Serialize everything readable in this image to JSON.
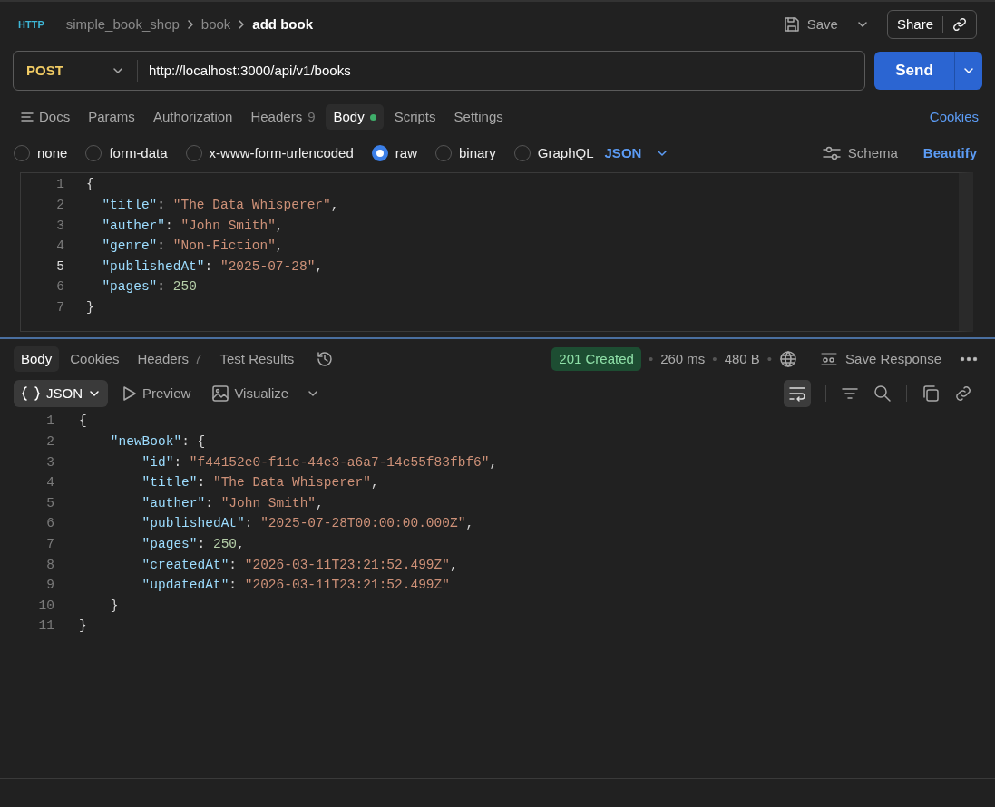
{
  "breadcrumb": {
    "badge": "HTTP",
    "items": [
      "simple_book_shop",
      "book"
    ],
    "current": "add book"
  },
  "actions": {
    "save": "Save",
    "share": "Share"
  },
  "request": {
    "method": "POST",
    "url": "http://localhost:3000/api/v1/books",
    "send": "Send"
  },
  "request_tabs": [
    {
      "label": "Docs",
      "kind": "docs",
      "selected": false
    },
    {
      "label": "Params",
      "selected": false
    },
    {
      "label": "Authorization",
      "selected": false
    },
    {
      "label": "Headers",
      "count": "9",
      "selected": false
    },
    {
      "label": "Body",
      "dot": true,
      "selected": true
    },
    {
      "label": "Scripts",
      "selected": false
    },
    {
      "label": "Settings",
      "selected": false
    }
  ],
  "cookies_link": "Cookies",
  "body_types": [
    {
      "label": "none",
      "selected": false
    },
    {
      "label": "form-data",
      "selected": false
    },
    {
      "label": "x-www-form-urlencoded",
      "selected": false
    },
    {
      "label": "raw",
      "selected": true
    },
    {
      "label": "binary",
      "selected": false
    },
    {
      "label": "GraphQL",
      "selected": false
    }
  ],
  "raw_format": "JSON",
  "schema": "Schema",
  "beautify": "Beautify",
  "request_body": [
    {
      "number": "1",
      "selected": false,
      "tokens": [
        {
          "kind": "punct",
          "text": "{"
        }
      ]
    },
    {
      "number": "2",
      "selected": false,
      "tokens": [
        {
          "kind": "key",
          "text": "  \"title\""
        },
        {
          "kind": "punct",
          "text": ": "
        },
        {
          "kind": "string",
          "text": "\"The Data Whisperer\""
        },
        {
          "kind": "punct",
          "text": ","
        }
      ]
    },
    {
      "number": "3",
      "selected": false,
      "tokens": [
        {
          "kind": "key",
          "text": "  \"auther\""
        },
        {
          "kind": "punct",
          "text": ": "
        },
        {
          "kind": "string",
          "text": "\"John Smith\""
        },
        {
          "kind": "punct",
          "text": ","
        }
      ]
    },
    {
      "number": "4",
      "selected": false,
      "tokens": [
        {
          "kind": "key",
          "text": "  \"genre\""
        },
        {
          "kind": "punct",
          "text": ": "
        },
        {
          "kind": "string",
          "text": "\"Non-Fiction\""
        },
        {
          "kind": "punct",
          "text": ","
        }
      ]
    },
    {
      "number": "5",
      "selected": true,
      "tokens": [
        {
          "kind": "key",
          "text": "  \"publishedAt\""
        },
        {
          "kind": "punct",
          "text": ": "
        },
        {
          "kind": "string",
          "text": "\"2025-07-28\""
        },
        {
          "kind": "punct",
          "text": ","
        }
      ]
    },
    {
      "number": "6",
      "selected": false,
      "tokens": [
        {
          "kind": "key",
          "text": "  \"pages\""
        },
        {
          "kind": "punct",
          "text": ": "
        },
        {
          "kind": "number",
          "text": "250"
        }
      ]
    },
    {
      "number": "7",
      "selected": false,
      "tokens": [
        {
          "kind": "punct",
          "text": "}"
        }
      ]
    }
  ],
  "response_tabs": [
    {
      "label": "Body",
      "selected": true
    },
    {
      "label": "Cookies",
      "selected": false
    },
    {
      "label": "Headers",
      "count": "7",
      "selected": false
    },
    {
      "label": "Test Results",
      "selected": false
    }
  ],
  "response_status": {
    "status": "201 Created",
    "separator": "•",
    "time": "260 ms",
    "size": "480 B",
    "save_response": "Save Response"
  },
  "response_views": [
    {
      "label": "JSON",
      "kind": "json",
      "selected": true
    },
    {
      "label": "Preview",
      "kind": "preview",
      "selected": false
    },
    {
      "label": "Visualize",
      "kind": "visualize",
      "selected": false
    }
  ],
  "wrap_lines": {
    "on": true
  },
  "response_body": [
    {
      "number": "1",
      "tokens": [
        {
          "kind": "punct",
          "text": "{"
        }
      ]
    },
    {
      "number": "2",
      "tokens": [
        {
          "kind": "key",
          "text": "    \"newBook\""
        },
        {
          "kind": "punct",
          "text": ": {"
        }
      ]
    },
    {
      "number": "3",
      "tokens": [
        {
          "kind": "key",
          "text": "        \"id\""
        },
        {
          "kind": "punct",
          "text": ": "
        },
        {
          "kind": "string",
          "text": "\"f44152e0-f11c-44e3-a6a7-14c55f83fbf6\""
        },
        {
          "kind": "punct",
          "text": ","
        }
      ]
    },
    {
      "number": "4",
      "tokens": [
        {
          "kind": "key",
          "text": "        \"title\""
        },
        {
          "kind": "punct",
          "text": ": "
        },
        {
          "kind": "string",
          "text": "\"The Data Whisperer\""
        },
        {
          "kind": "punct",
          "text": ","
        }
      ]
    },
    {
      "number": "5",
      "tokens": [
        {
          "kind": "key",
          "text": "        \"auther\""
        },
        {
          "kind": "punct",
          "text": ": "
        },
        {
          "kind": "string",
          "text": "\"John Smith\""
        },
        {
          "kind": "punct",
          "text": ","
        }
      ]
    },
    {
      "number": "6",
      "tokens": [
        {
          "kind": "key",
          "text": "        \"publishedAt\""
        },
        {
          "kind": "punct",
          "text": ": "
        },
        {
          "kind": "string",
          "text": "\"2025-07-28T00:00:00.000Z\""
        },
        {
          "kind": "punct",
          "text": ","
        }
      ]
    },
    {
      "number": "7",
      "tokens": [
        {
          "kind": "key",
          "text": "        \"pages\""
        },
        {
          "kind": "punct",
          "text": ": "
        },
        {
          "kind": "number",
          "text": "250"
        },
        {
          "kind": "punct",
          "text": ","
        }
      ]
    },
    {
      "number": "8",
      "tokens": [
        {
          "kind": "key",
          "text": "        \"createdAt\""
        },
        {
          "kind": "punct",
          "text": ": "
        },
        {
          "kind": "string",
          "text": "\"2026-03-11T23:21:52.499Z\""
        },
        {
          "kind": "punct",
          "text": ","
        }
      ]
    },
    {
      "number": "9",
      "tokens": [
        {
          "kind": "key",
          "text": "        \"updatedAt\""
        },
        {
          "kind": "punct",
          "text": ": "
        },
        {
          "kind": "string",
          "text": "\"2026-03-11T23:21:52.499Z\""
        }
      ]
    },
    {
      "number": "10",
      "tokens": [
        {
          "kind": "punct",
          "text": "    }"
        }
      ]
    },
    {
      "number": "11",
      "tokens": [
        {
          "kind": "punct",
          "text": "}"
        }
      ]
    }
  ]
}
